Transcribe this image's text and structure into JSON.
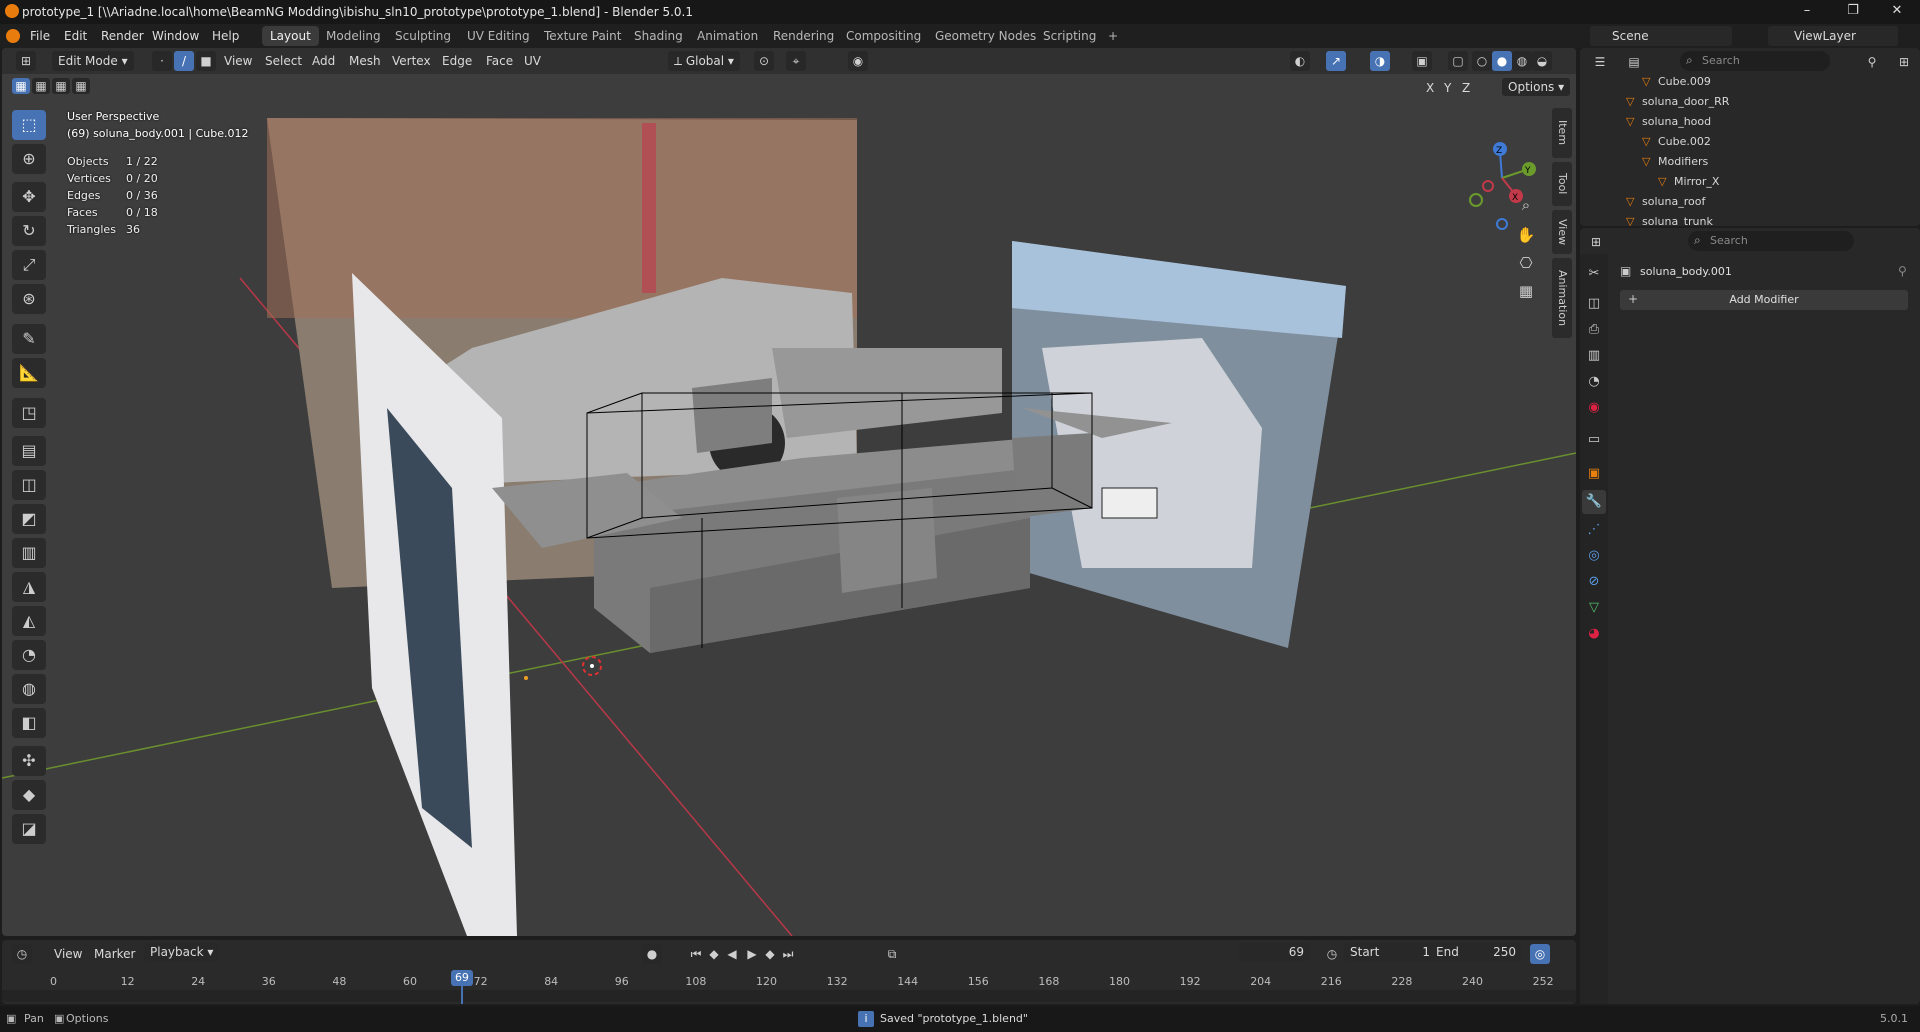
{
  "window": {
    "title": "prototype_1 [\\\\Ariadne.local\\home\\BeamNG Modding\\ibishu_sln10_prototype\\prototype_1.blend] - Blender 5.0.1",
    "minimize": "–",
    "maximize": "❐",
    "close": "✕"
  },
  "menu": [
    "File",
    "Edit",
    "Render",
    "Window",
    "Help"
  ],
  "workspaces": [
    "Layout",
    "Modeling",
    "Sculpting",
    "UV Editing",
    "Texture Paint",
    "Shading",
    "Animation",
    "Rendering",
    "Compositing",
    "Geometry Nodes",
    "Scripting"
  ],
  "add_workspace": "+",
  "scene": {
    "label": "Scene",
    "viewlayer": "ViewLayer"
  },
  "viewport_header": {
    "mode": "Edit Mode",
    "menus": [
      "View",
      "Select",
      "Add",
      "Mesh",
      "Vertex",
      "Edge",
      "Face",
      "UV"
    ],
    "orientation": "Global",
    "options": "Options",
    "axes": [
      "X",
      "Y",
      "Z"
    ]
  },
  "overlay": {
    "perspective": "User Perspective",
    "object": "(69) soluna_body.001 | Cube.012",
    "stats": [
      {
        "label": "Objects",
        "value": "1 / 22"
      },
      {
        "label": "Vertices",
        "value": "0 / 20"
      },
      {
        "label": "Edges",
        "value": "0 / 36"
      },
      {
        "label": "Faces",
        "value": "0 / 18"
      },
      {
        "label": "Triangles",
        "value": "36"
      }
    ]
  },
  "side_tabs": [
    "Item",
    "Tool",
    "View",
    "Animation"
  ],
  "gizmo": {
    "x": "X",
    "y": "Y",
    "z": "Z"
  },
  "timeline": {
    "menus": [
      "View",
      "Marker",
      "Playback"
    ],
    "current_frame": "69",
    "start_label": "Start",
    "start": "1",
    "end_label": "End",
    "end": "250",
    "ticks": [
      "0",
      "12",
      "24",
      "36",
      "48",
      "60",
      "72",
      "84",
      "96",
      "108",
      "120",
      "132",
      "144",
      "156",
      "168",
      "180",
      "192",
      "204",
      "216",
      "228",
      "240",
      "252"
    ],
    "playhead": "69"
  },
  "statusbar": {
    "pan": "Pan",
    "options": "Options",
    "message": "Saved \"prototype_1.blend\"",
    "version": "5.0.1"
  },
  "outliner": {
    "search_placeholder": "Search",
    "rows": [
      {
        "label": "Cube.009",
        "indent": 3
      },
      {
        "label": "soluna_door_RR",
        "indent": 2
      },
      {
        "label": "soluna_hood",
        "indent": 2
      },
      {
        "label": "Cube.002",
        "indent": 3
      },
      {
        "label": "Modifiers",
        "indent": 3
      },
      {
        "label": "Mirror_X",
        "indent": 4
      },
      {
        "label": "soluna_roof",
        "indent": 2
      },
      {
        "label": "soluna_trunk",
        "indent": 2
      }
    ]
  },
  "properties": {
    "search_placeholder": "Search",
    "object_name": "soluna_body.001",
    "add_modifier": "Add Modifier"
  },
  "colors": {
    "accent": "#4772b3",
    "x_axis": "#c2394a",
    "y_axis": "#6a9b2b",
    "z_axis": "#3f7ad6"
  }
}
